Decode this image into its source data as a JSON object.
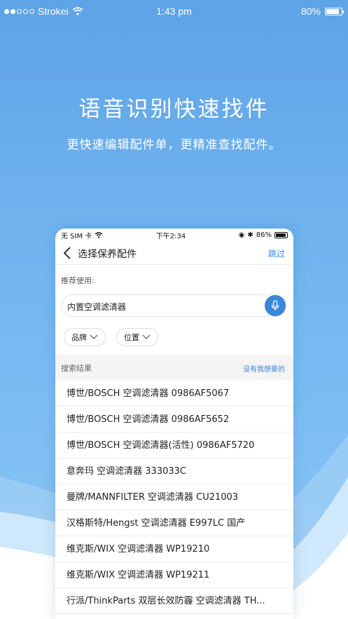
{
  "status_bar": {
    "carrier": "Strokei",
    "time": "1:43 pm",
    "battery": "80%",
    "battery_level": 0.8
  },
  "hero": {
    "title": "语音识别快速找件",
    "subtitle": "更快速编辑配件单，更精准查找配件。"
  },
  "phone": {
    "status": {
      "sim": "无 SIM 卡",
      "time": "下午2:34",
      "battery": "86%"
    },
    "nav": {
      "title": "选择保养配件",
      "skip": "跳过"
    },
    "recommend_label": "推荐使用:",
    "search_value": "内置空调滤清器",
    "filters": [
      "品牌",
      "位置"
    ],
    "results_label": "搜索结果",
    "no_match_link": "没有我想要的",
    "results": [
      "博世/BOSCH 空调滤清器 0986AF5067",
      "博世/BOSCH 空调滤清器 0986AF5652",
      "博世/BOSCH 空调滤清器(活性) 0986AF5720",
      "意奔玛 空调滤清器 333033C",
      "曼牌/MANNFILTER 空调滤清器 CU21003",
      "汉格斯特/Hengst 空调滤清器 E997LC 国产",
      "维克斯/WIX 空调滤清器 WP19210",
      "维克斯/WIX 空调滤清器 WP19211",
      "行派/ThinkParts 双层长效防霾 空调滤清器 TH..."
    ]
  },
  "colors": {
    "accent": "#3a86d8",
    "background_top": "#5da3e6",
    "background_bottom": "#8cc6f4"
  }
}
